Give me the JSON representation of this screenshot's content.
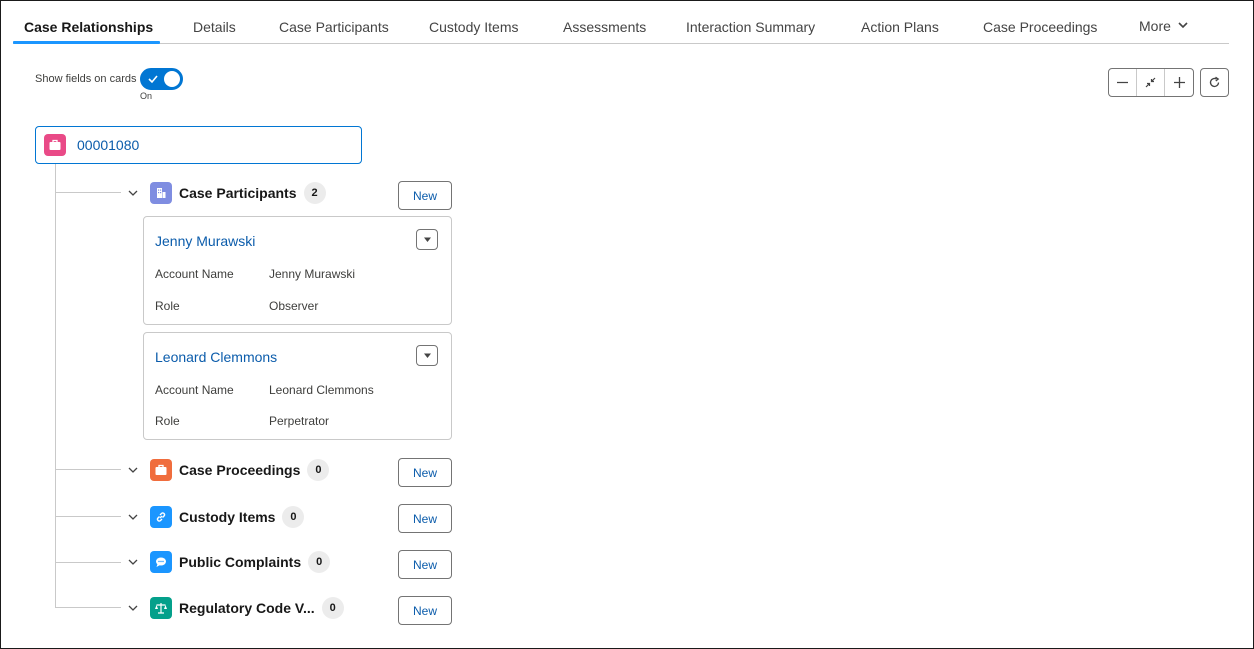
{
  "tabs": [
    {
      "label": "Case Relationships",
      "active": true
    },
    {
      "label": "Details"
    },
    {
      "label": "Case Participants"
    },
    {
      "label": "Custody Items"
    },
    {
      "label": "Assessments"
    },
    {
      "label": "Interaction Summary"
    },
    {
      "label": "Action Plans"
    },
    {
      "label": "Case Proceedings"
    }
  ],
  "more_label": "More",
  "toggle": {
    "label": "Show fields on cards",
    "state": "On",
    "checked": true
  },
  "root": {
    "label": "00001080",
    "icon": "briefcase-icon",
    "color": "#e94a87"
  },
  "sections": [
    {
      "title": "Case Participants",
      "count": "2",
      "new_label": "New",
      "icon": "building-icon",
      "color": "#7f8de1"
    },
    {
      "title": "Case Proceedings",
      "count": "0",
      "new_label": "New",
      "icon": "briefcase-icon",
      "color": "#f06d3d"
    },
    {
      "title": "Custody Items",
      "count": "0",
      "new_label": "New",
      "icon": "link-icon",
      "color": "#1b96ff"
    },
    {
      "title": "Public Complaints",
      "count": "0",
      "new_label": "New",
      "icon": "chat-icon",
      "color": "#1b96ff"
    },
    {
      "title": "Regulatory Code V...",
      "count": "0",
      "new_label": "New",
      "icon": "scales-icon",
      "color": "#04a08b"
    }
  ],
  "records": [
    {
      "name": "Jenny Murawski",
      "fields": [
        {
          "label": "Account Name",
          "value": "Jenny Murawski"
        },
        {
          "label": "Role",
          "value": "Observer"
        }
      ]
    },
    {
      "name": "Leonard Clemmons",
      "fields": [
        {
          "label": "Account Name",
          "value": "Leonard Clemmons"
        },
        {
          "label": "Role",
          "value": "Perpetrator"
        }
      ]
    }
  ],
  "colors": {
    "accent": "#0176d3",
    "link": "#0b5cab",
    "border": "#c9c9c9"
  }
}
